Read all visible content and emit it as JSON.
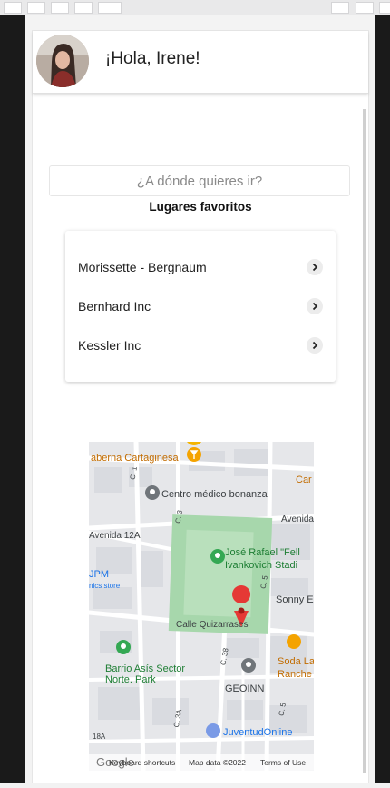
{
  "header": {
    "greeting": "¡Hola, Irene!"
  },
  "search": {
    "placeholder": "¿A dónde quieres ir?"
  },
  "favorites": {
    "title": "Lugares favoritos",
    "items": [
      "Morissette - Bergnaum",
      "Bernhard Inc",
      "Kessler Inc"
    ]
  },
  "map": {
    "labels": {
      "taberna": "aberna Cartaginesa",
      "centro": "Centro médico bonanza",
      "c1": "C. 1",
      "c3": "C. 3",
      "avenida": "Avenida",
      "avenida12a": "Avenida 12A",
      "car": "Car",
      "jpm": "JPM",
      "jpm_sub": "nics store",
      "stadium1": "José Rafael \"Fell",
      "stadium2": "Ivankovich Stadi",
      "c5": "C. 5",
      "sonny": "Sonny E",
      "quizarrases": "Calle Quizarrases",
      "barrio1": "Barrio Asís Sector",
      "barrio2": "Norte. Park",
      "c38": "C. 38",
      "soda1": "Soda La",
      "soda2": "Ranche",
      "geoinn": "GEOINN",
      "c3a": "C. 3A",
      "c5b": "C. 5",
      "juventud": "JuventudOnline",
      "l18a": "18A"
    },
    "footer": {
      "google": "Google",
      "shortcuts": "Keyboard shortcuts",
      "mapdata": "Map data ©2022",
      "terms": "Terms of Use"
    }
  }
}
